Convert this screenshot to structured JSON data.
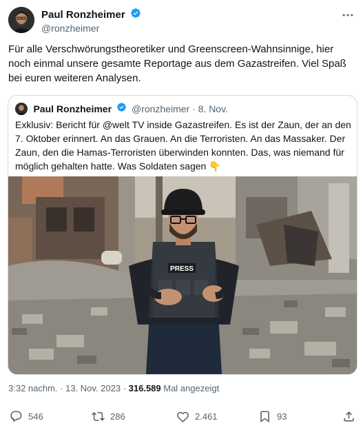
{
  "author": {
    "name": "Paul Ronzheimer",
    "handle": "@ronzheimer"
  },
  "tweet": {
    "text": "Für alle Verschwörungstheoretiker und Greenscreen-Wahnsinnige, hier noch einmal unsere gesamte Reportage aus dem Gazastreifen. Viel Spaß bei euren weiteren Analysen."
  },
  "quote": {
    "name": "Paul Ronzheimer",
    "handle_date": "@ronzheimer · 8. Nov.",
    "text": "Exklusiv: Bericht für @welt TV inside Gazastreifen. Es ist der Zaun, der an den 7. Oktober erinnert. An das Grauen. An die Terroristen. An das Massaker. Der Zaun, den die Hamas-Terroristen überwinden konnten. Das, was niemand für möglich gehalten hatte. Was Soldaten sagen",
    "emoji": "👇",
    "media": {
      "vest_label": "PRESS"
    }
  },
  "meta": {
    "time_date": "3:32 nachm. · 13. Nov. 2023 · ",
    "views_count": "316.589",
    "views_label": " Mal angezeigt"
  },
  "actions": {
    "reply_count": "546",
    "retweet_count": "286",
    "like_count": "2.461",
    "bookmark_count": "93"
  },
  "colors": {
    "verified": "#1d9bf0",
    "secondary_text": "#536471",
    "primary_text": "#0f1419",
    "border": "#cfd9de"
  },
  "icons": [
    "more-icon",
    "verified-icon",
    "reply-icon",
    "retweet-icon",
    "like-icon",
    "bookmark-icon",
    "share-icon"
  ]
}
